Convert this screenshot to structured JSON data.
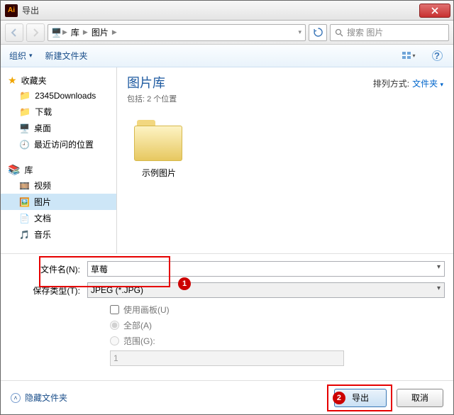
{
  "titlebar": {
    "title": "导出"
  },
  "breadcrumbs": {
    "root_icon": "computer-icon",
    "lib": "库",
    "pic": "图片"
  },
  "search": {
    "placeholder": "搜索 图片"
  },
  "toolbar": {
    "organize": "组织",
    "newfolder": "新建文件夹"
  },
  "sidebar": {
    "favorites": "收藏夹",
    "fav_items": [
      "2345Downloads",
      "下载",
      "桌面",
      "最近访问的位置"
    ],
    "libraries": "库",
    "lib_items": [
      "视频",
      "图片",
      "文档",
      "音乐"
    ]
  },
  "content": {
    "heading": "图片库",
    "subtitle": "包括: 2 个位置",
    "sort_label": "排列方式:",
    "sort_value": "文件夹",
    "folder1": "示例图片"
  },
  "form": {
    "filename_label": "文件名(N):",
    "filename_value": "草莓",
    "type_label": "保存类型(T):",
    "type_value": "JPEG (*.JPG)",
    "use_artboard": "使用画板(U)",
    "all": "全部(A)",
    "range": "范围(G):",
    "range_value": "1"
  },
  "footer": {
    "hide_folders": "隐藏文件夹",
    "export": "导出",
    "cancel": "取消"
  },
  "badges": {
    "b1": "1",
    "b2": "2"
  }
}
